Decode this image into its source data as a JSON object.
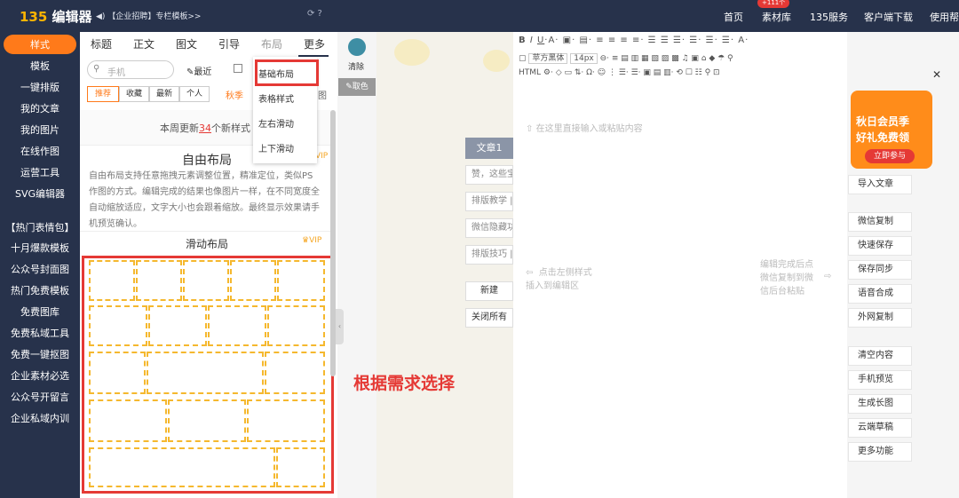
{
  "topbar": {
    "logo_num": "135",
    "logo_text": "编辑器",
    "announcement": "【企业招聘】专栏模板>>",
    "nav": [
      "首页",
      "素材库",
      "135服务",
      "客户端下载",
      "使用帮"
    ],
    "badge": "+111个"
  },
  "sidebar": {
    "items": [
      "样式",
      "模板",
      "一键排版",
      "我的文章",
      "我的图片",
      "在线作图",
      "运营工具",
      "SVG编辑器",
      "【热门表情包】",
      "十月爆款模板",
      "公众号封面图",
      "热门免费模板",
      "免费图库",
      "免费私域工具",
      "免费一键抠图",
      "企业素材必选",
      "公众号开留言",
      "企业私域内训"
    ]
  },
  "panel": {
    "tabs": [
      "标题",
      "正文",
      "图文",
      "引导",
      "布局",
      "更多"
    ],
    "search_placeholder": "手机",
    "recent": "最近",
    "chips": [
      "推荐",
      "收藏",
      "最新",
      "个人"
    ],
    "season": "秋季",
    "notice_prefix": "本周更新",
    "notice_count": "34",
    "notice_suffix": "个新样式",
    "free_title": "自由布局",
    "vip": "VIP",
    "description": "自由布局支持任意拖拽元素调整位置，精准定位，类似PS作图的方式。编辑完成的结果也像图片一样，在不同宽度全自动缩放适应，文字大小也会跟着缩放。最终显示效果请手机预览确认。",
    "slide_title": "滑动布局",
    "slide_vip": "VIP"
  },
  "dropdown": {
    "items": [
      "基础布局",
      "表格样式",
      "左右滑动",
      "上下滑动"
    ]
  },
  "color": {
    "clear": "清除",
    "pick": "取色"
  },
  "editor": {
    "placeholder": "在这里直接输入或粘贴内容",
    "font": "苹方黑体",
    "size": "14px",
    "left_hint": "点击左侧样式\n插入到编辑区",
    "right_hint": "编辑完成后点\n微信复制到微\n信后台粘贴"
  },
  "mid": {
    "article": "文章1",
    "items": [
      "赞，这些宝",
      "排版教学 |",
      "微信隐藏功",
      "排版技巧 |"
    ],
    "new": "新建",
    "close_all": "关闭所有"
  },
  "right": {
    "promo_1": "秋日会员季",
    "promo_2": "好礼免费领",
    "promo_btn": "立即参与",
    "buttons": [
      "导入文章",
      "微信复制",
      "快速保存",
      "保存同步",
      "语音合成",
      "外网复制",
      "清空内容",
      "手机预览",
      "生成长图",
      "云端草稿",
      "更多功能"
    ]
  },
  "caption": "根据需求选择"
}
